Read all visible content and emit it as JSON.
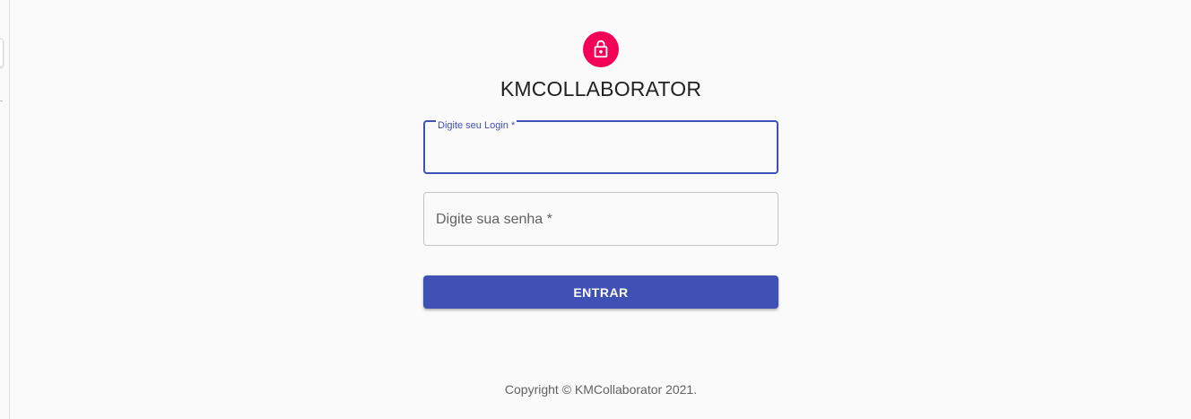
{
  "brand": {
    "title": "KMCOLLABORATOR",
    "accent_color": "#f50057",
    "primary_color": "#3f51b5",
    "icon": "lock-icon"
  },
  "login_form": {
    "login_label": "Digite seu Login *",
    "login_value": "",
    "password_label": "Digite sua senha *",
    "password_value": "",
    "submit_label": "ENTRAR"
  },
  "footer": {
    "copyright_text": "Copyright © KMCollaborator 2021."
  }
}
